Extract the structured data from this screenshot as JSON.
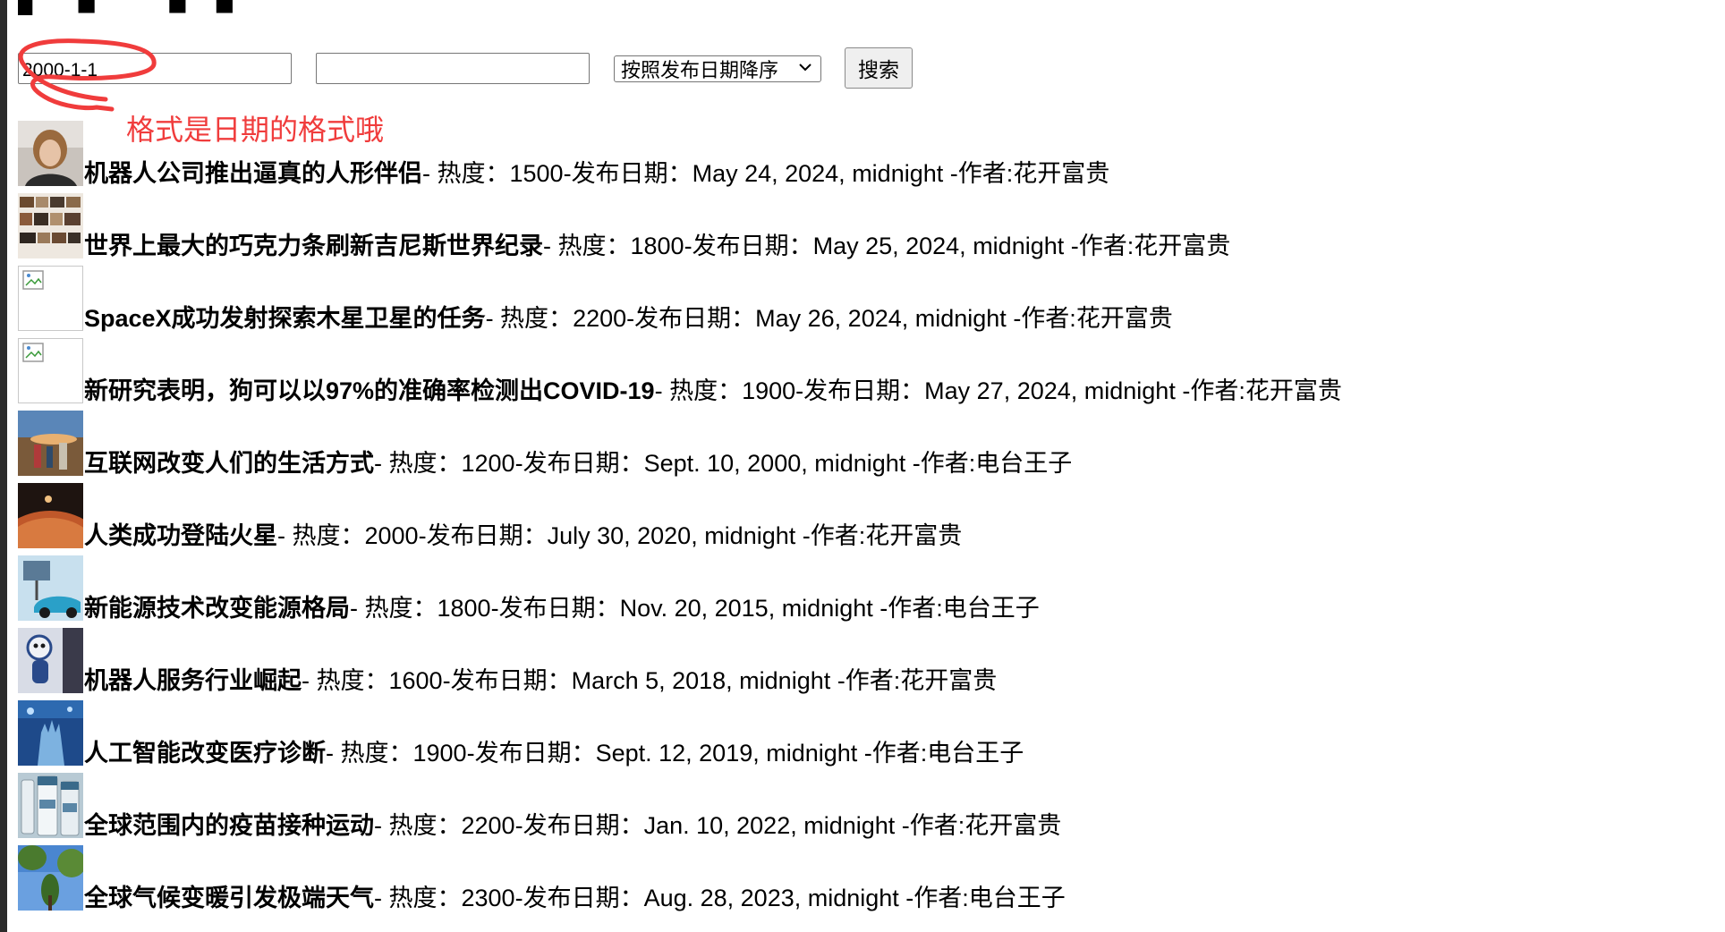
{
  "search": {
    "start_value": "2000-1-1",
    "end_value": "",
    "sort_selected": "按照发布日期降序",
    "button_label": "搜索"
  },
  "annotation": {
    "text": "格式是日期的格式哦",
    "color": "#f03c3c"
  },
  "labels": {
    "heat": "- 热度：",
    "date": "-发布日期：",
    "author": " -作者:"
  },
  "news": [
    {
      "title": "机器人公司推出逼真的人形伴侣",
      "heat": "1500",
      "date": "May 24, 2024, midnight",
      "author": "花开富贵",
      "thumb": "portrait-image"
    },
    {
      "title": "世界上最大的巧克力条刷新吉尼斯世界纪录",
      "heat": "1800",
      "date": "May 25, 2024, midnight",
      "author": "花开富贵",
      "thumb": "crowd-collage-image"
    },
    {
      "title": "SpaceX成功发射探索木星卫星的任务",
      "heat": "2200",
      "date": "May 26, 2024, midnight",
      "author": "花开富贵",
      "thumb": "broken-image-icon"
    },
    {
      "title": "新研究表明，狗可以以97%的准确率检测出COVID-19",
      "heat": "1900",
      "date": "May 27, 2024, midnight",
      "author": "花开富贵",
      "thumb": "broken-image-icon"
    },
    {
      "title": "互联网改变人们的生活方式",
      "heat": "1200",
      "date": "Sept. 10, 2000, midnight",
      "author": "电台王子",
      "thumb": "people-landscape-image"
    },
    {
      "title": "人类成功登陆火星",
      "heat": "2000",
      "date": "July 30, 2020, midnight",
      "author": "花开富贵",
      "thumb": "mars-image"
    },
    {
      "title": "新能源技术改变能源格局",
      "heat": "1800",
      "date": "Nov. 20, 2015, midnight",
      "author": "电台王子",
      "thumb": "electric-car-image"
    },
    {
      "title": "机器人服务行业崛起",
      "heat": "1600",
      "date": "March 5, 2018, midnight",
      "author": "花开富贵",
      "thumb": "robot-image"
    },
    {
      "title": "人工智能改变医疗诊断",
      "heat": "1900",
      "date": "Sept. 12, 2019, midnight",
      "author": "电台王子",
      "thumb": "medical-hand-image"
    },
    {
      "title": "全球范围内的疫苗接种运动",
      "heat": "2200",
      "date": "Jan. 10, 2022, midnight",
      "author": "花开富贵",
      "thumb": "vaccine-vials-image"
    },
    {
      "title": "全球气候变暖引发极端天气",
      "heat": "2300",
      "date": "Aug. 28, 2023, midnight",
      "author": "电台王子",
      "thumb": "trees-sky-image"
    }
  ]
}
